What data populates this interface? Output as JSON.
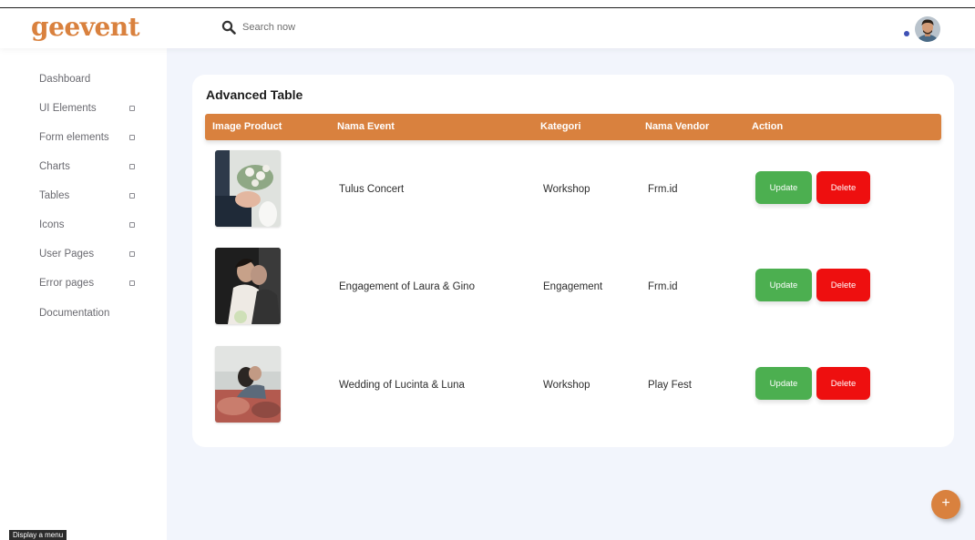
{
  "brand": {
    "logo_text": "geevent",
    "accent_color": "#d9813e"
  },
  "header": {
    "search": {
      "label": "Search now",
      "icon": "search-icon"
    },
    "status_dot_color": "#3f51b5",
    "avatar": "user-avatar"
  },
  "sidebar": {
    "items": [
      {
        "label": "Dashboard",
        "has_submenu": false
      },
      {
        "label": "UI Elements",
        "has_submenu": true
      },
      {
        "label": "Form elements",
        "has_submenu": true
      },
      {
        "label": "Charts",
        "has_submenu": true
      },
      {
        "label": "Tables",
        "has_submenu": true
      },
      {
        "label": "Icons",
        "has_submenu": true
      },
      {
        "label": "User Pages",
        "has_submenu": true
      },
      {
        "label": "Error pages",
        "has_submenu": true
      },
      {
        "label": "Documentation",
        "has_submenu": false
      }
    ]
  },
  "tooltip": "Display a menu",
  "main": {
    "card_title": "Advanced Table",
    "table": {
      "columns": [
        "Image Product",
        "Nama Event",
        "Kategori",
        "Nama Vendor",
        "Action"
      ],
      "rows": [
        {
          "image": "wedding-bouquet-photo",
          "event": "Tulus Concert",
          "category": "Workshop",
          "vendor": "Frm.id",
          "update_label": "Update",
          "delete_label": "Delete"
        },
        {
          "image": "engagement-couple-photo",
          "event": "Engagement of Laura & Gino",
          "category": "Engagement",
          "vendor": "Frm.id",
          "update_label": "Update",
          "delete_label": "Delete"
        },
        {
          "image": "wedding-kiss-photo",
          "event": "Wedding of Lucinta & Luna",
          "category": "Workshop",
          "vendor": "Play Fest",
          "update_label": "Update",
          "delete_label": "Delete"
        }
      ]
    },
    "colors": {
      "update": "#4caf50",
      "delete": "#ee0f0f",
      "page_background": "#f2f5fc"
    }
  },
  "fab": {
    "label": "+",
    "icon": "plus-icon"
  }
}
